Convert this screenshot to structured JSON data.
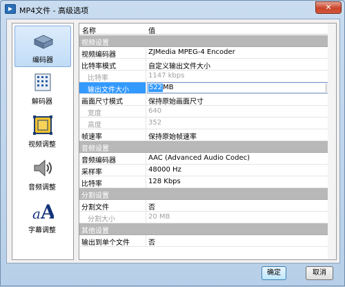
{
  "window": {
    "title": "MP4文件 - 高级选项",
    "close_label": "✕"
  },
  "nav": [
    {
      "label": "编码器",
      "icon": "encoder-icon",
      "active": true
    },
    {
      "label": "解码器",
      "icon": "decoder-icon",
      "active": false
    },
    {
      "label": "视频调整",
      "icon": "video-adjust-icon",
      "active": false
    },
    {
      "label": "音频调整",
      "icon": "audio-adjust-icon",
      "active": false
    },
    {
      "label": "字幕调整",
      "icon": "subtitle-adjust-icon",
      "active": false
    }
  ],
  "grid": {
    "headers": {
      "name": "名称",
      "value": "值"
    },
    "rows": [
      {
        "kind": "section",
        "name": "视频设置",
        "value": ""
      },
      {
        "kind": "item",
        "name": "视频编码器",
        "value": "ZJMedia MPEG-4 Encoder"
      },
      {
        "kind": "item",
        "name": "比特率模式",
        "value": "自定义输出文件大小"
      },
      {
        "kind": "disabled",
        "name": "比特率",
        "value": "1147 kbps"
      },
      {
        "kind": "selected",
        "name": "输出文件大小",
        "value_selected": "522",
        "value_unit": "MB"
      },
      {
        "kind": "item",
        "name": "画面尺寸模式",
        "value": "保持原始画面尺寸"
      },
      {
        "kind": "disabled",
        "name": "宽度",
        "value": "640"
      },
      {
        "kind": "disabled",
        "name": "高度",
        "value": "352"
      },
      {
        "kind": "item",
        "name": "帧速率",
        "value": "保持原始帧速率"
      },
      {
        "kind": "section",
        "name": "音频设置",
        "value": ""
      },
      {
        "kind": "item",
        "name": "音频编码器",
        "value": "AAC (Advanced Audio Codec)"
      },
      {
        "kind": "item",
        "name": "采样率",
        "value": "48000 Hz"
      },
      {
        "kind": "item",
        "name": "比特率",
        "value": "128 Kbps"
      },
      {
        "kind": "section",
        "name": "分割设置",
        "value": ""
      },
      {
        "kind": "item",
        "name": "分割文件",
        "value": "否"
      },
      {
        "kind": "disabled",
        "name": "分割大小",
        "value": "20 MB"
      },
      {
        "kind": "section",
        "name": "其他设置",
        "value": ""
      },
      {
        "kind": "item",
        "name": "输出到单个文件",
        "value": "否"
      }
    ]
  },
  "buttons": {
    "ok": "确定",
    "cancel": "取消"
  },
  "colors": {
    "selection": "#3399ff",
    "section_bg": "#b8b8b8",
    "close_button": "#c9452a"
  }
}
